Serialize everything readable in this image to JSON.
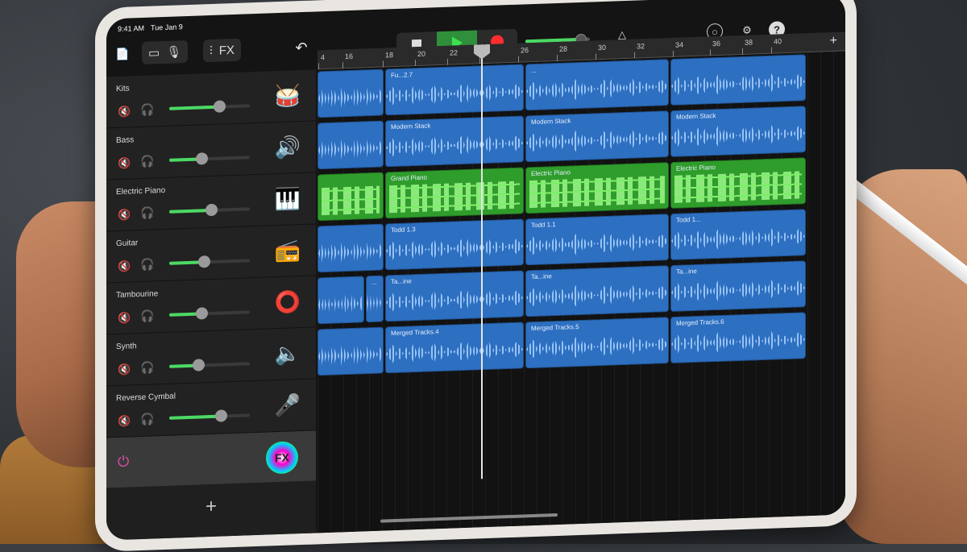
{
  "status_bar": {
    "time": "9:41 AM",
    "date": "Tue Jan 9"
  },
  "toolbar": {
    "fx_label": "FX",
    "undo_icon": "undo-icon"
  },
  "ruler": {
    "ticks": [
      "4",
      "16",
      "18",
      "20",
      "22",
      "24",
      "26",
      "28",
      "30",
      "32",
      "34",
      "36",
      "38",
      "40"
    ],
    "add_label": "+"
  },
  "tracks": [
    {
      "name": "Kits",
      "volume": 0.62,
      "icon": "drum-kit-icon",
      "glyph": "🥁"
    },
    {
      "name": "Bass",
      "volume": 0.4,
      "icon": "bass-amp-icon",
      "glyph": "🔊"
    },
    {
      "name": "Electric Piano",
      "volume": 0.52,
      "icon": "piano-icon",
      "glyph": "🎹"
    },
    {
      "name": "Guitar",
      "volume": 0.43,
      "icon": "guitar-amp-icon",
      "glyph": "📻"
    },
    {
      "name": "Tambourine",
      "volume": 0.4,
      "icon": "tambourine-icon",
      "glyph": "⭕"
    },
    {
      "name": "Synth",
      "volume": 0.36,
      "icon": "speaker-icon",
      "glyph": "🔈"
    },
    {
      "name": "Reverse Cymbal",
      "volume": 0.64,
      "icon": "microphone-icon",
      "glyph": "🎤"
    }
  ],
  "fx_row": {
    "label": "FX"
  },
  "add_track": {
    "label": "+"
  },
  "lanes": [
    {
      "type": "audio",
      "regions": [
        {
          "label": "",
          "w": 84
        },
        {
          "label": "Fu...2.7",
          "w": 174
        },
        {
          "label": "...",
          "w": 180
        },
        {
          "label": "",
          "w": 170
        }
      ]
    },
    {
      "type": "audio",
      "regions": [
        {
          "label": "",
          "w": 84
        },
        {
          "label": "Modern Stack",
          "w": 174
        },
        {
          "label": "Modern Stack",
          "w": 180
        },
        {
          "label": "Modern Stack",
          "w": 170
        }
      ]
    },
    {
      "type": "midi",
      "regions": [
        {
          "label": "",
          "w": 84
        },
        {
          "label": "Grand Piano",
          "w": 174
        },
        {
          "label": "Electric Piano",
          "w": 180
        },
        {
          "label": "Electric Piano",
          "w": 170
        }
      ]
    },
    {
      "type": "audio",
      "regions": [
        {
          "label": "",
          "w": 84
        },
        {
          "label": "Todd 1.3",
          "w": 174
        },
        {
          "label": "Todd 1.1",
          "w": 180
        },
        {
          "label": "Todd 1...",
          "w": 170
        }
      ]
    },
    {
      "type": "audio",
      "regions": [
        {
          "label": "",
          "w": 60
        },
        {
          "label": "...",
          "w": 24
        },
        {
          "label": "Ta...ine",
          "w": 174
        },
        {
          "label": "Ta...ine",
          "w": 180
        },
        {
          "label": "Ta...ine",
          "w": 170
        }
      ]
    },
    {
      "type": "audio",
      "regions": [
        {
          "label": "",
          "w": 84
        },
        {
          "label": "Merged Tracks.4",
          "w": 174
        },
        {
          "label": "Merged Tracks.5",
          "w": 180
        },
        {
          "label": "Merged Tracks.6",
          "w": 170
        }
      ]
    }
  ],
  "colors": {
    "audio": "#2d6fc0",
    "midi": "#2f9d2c",
    "accent": "#4cd964",
    "record": "#ff2d2d"
  }
}
